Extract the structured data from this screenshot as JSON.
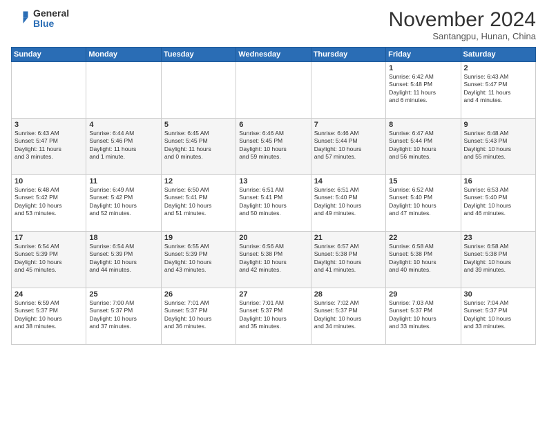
{
  "header": {
    "logo_general": "General",
    "logo_blue": "Blue",
    "month_title": "November 2024",
    "location": "Santangpu, Hunan, China"
  },
  "calendar": {
    "headers": [
      "Sunday",
      "Monday",
      "Tuesday",
      "Wednesday",
      "Thursday",
      "Friday",
      "Saturday"
    ],
    "weeks": [
      [
        {
          "day": "",
          "info": ""
        },
        {
          "day": "",
          "info": ""
        },
        {
          "day": "",
          "info": ""
        },
        {
          "day": "",
          "info": ""
        },
        {
          "day": "",
          "info": ""
        },
        {
          "day": "1",
          "info": "Sunrise: 6:42 AM\nSunset: 5:48 PM\nDaylight: 11 hours\nand 6 minutes."
        },
        {
          "day": "2",
          "info": "Sunrise: 6:43 AM\nSunset: 5:47 PM\nDaylight: 11 hours\nand 4 minutes."
        }
      ],
      [
        {
          "day": "3",
          "info": "Sunrise: 6:43 AM\nSunset: 5:47 PM\nDaylight: 11 hours\nand 3 minutes."
        },
        {
          "day": "4",
          "info": "Sunrise: 6:44 AM\nSunset: 5:46 PM\nDaylight: 11 hours\nand 1 minute."
        },
        {
          "day": "5",
          "info": "Sunrise: 6:45 AM\nSunset: 5:45 PM\nDaylight: 11 hours\nand 0 minutes."
        },
        {
          "day": "6",
          "info": "Sunrise: 6:46 AM\nSunset: 5:45 PM\nDaylight: 10 hours\nand 59 minutes."
        },
        {
          "day": "7",
          "info": "Sunrise: 6:46 AM\nSunset: 5:44 PM\nDaylight: 10 hours\nand 57 minutes."
        },
        {
          "day": "8",
          "info": "Sunrise: 6:47 AM\nSunset: 5:44 PM\nDaylight: 10 hours\nand 56 minutes."
        },
        {
          "day": "9",
          "info": "Sunrise: 6:48 AM\nSunset: 5:43 PM\nDaylight: 10 hours\nand 55 minutes."
        }
      ],
      [
        {
          "day": "10",
          "info": "Sunrise: 6:48 AM\nSunset: 5:42 PM\nDaylight: 10 hours\nand 53 minutes."
        },
        {
          "day": "11",
          "info": "Sunrise: 6:49 AM\nSunset: 5:42 PM\nDaylight: 10 hours\nand 52 minutes."
        },
        {
          "day": "12",
          "info": "Sunrise: 6:50 AM\nSunset: 5:41 PM\nDaylight: 10 hours\nand 51 minutes."
        },
        {
          "day": "13",
          "info": "Sunrise: 6:51 AM\nSunset: 5:41 PM\nDaylight: 10 hours\nand 50 minutes."
        },
        {
          "day": "14",
          "info": "Sunrise: 6:51 AM\nSunset: 5:40 PM\nDaylight: 10 hours\nand 49 minutes."
        },
        {
          "day": "15",
          "info": "Sunrise: 6:52 AM\nSunset: 5:40 PM\nDaylight: 10 hours\nand 47 minutes."
        },
        {
          "day": "16",
          "info": "Sunrise: 6:53 AM\nSunset: 5:40 PM\nDaylight: 10 hours\nand 46 minutes."
        }
      ],
      [
        {
          "day": "17",
          "info": "Sunrise: 6:54 AM\nSunset: 5:39 PM\nDaylight: 10 hours\nand 45 minutes."
        },
        {
          "day": "18",
          "info": "Sunrise: 6:54 AM\nSunset: 5:39 PM\nDaylight: 10 hours\nand 44 minutes."
        },
        {
          "day": "19",
          "info": "Sunrise: 6:55 AM\nSunset: 5:39 PM\nDaylight: 10 hours\nand 43 minutes."
        },
        {
          "day": "20",
          "info": "Sunrise: 6:56 AM\nSunset: 5:38 PM\nDaylight: 10 hours\nand 42 minutes."
        },
        {
          "day": "21",
          "info": "Sunrise: 6:57 AM\nSunset: 5:38 PM\nDaylight: 10 hours\nand 41 minutes."
        },
        {
          "day": "22",
          "info": "Sunrise: 6:58 AM\nSunset: 5:38 PM\nDaylight: 10 hours\nand 40 minutes."
        },
        {
          "day": "23",
          "info": "Sunrise: 6:58 AM\nSunset: 5:38 PM\nDaylight: 10 hours\nand 39 minutes."
        }
      ],
      [
        {
          "day": "24",
          "info": "Sunrise: 6:59 AM\nSunset: 5:37 PM\nDaylight: 10 hours\nand 38 minutes."
        },
        {
          "day": "25",
          "info": "Sunrise: 7:00 AM\nSunset: 5:37 PM\nDaylight: 10 hours\nand 37 minutes."
        },
        {
          "day": "26",
          "info": "Sunrise: 7:01 AM\nSunset: 5:37 PM\nDaylight: 10 hours\nand 36 minutes."
        },
        {
          "day": "27",
          "info": "Sunrise: 7:01 AM\nSunset: 5:37 PM\nDaylight: 10 hours\nand 35 minutes."
        },
        {
          "day": "28",
          "info": "Sunrise: 7:02 AM\nSunset: 5:37 PM\nDaylight: 10 hours\nand 34 minutes."
        },
        {
          "day": "29",
          "info": "Sunrise: 7:03 AM\nSunset: 5:37 PM\nDaylight: 10 hours\nand 33 minutes."
        },
        {
          "day": "30",
          "info": "Sunrise: 7:04 AM\nSunset: 5:37 PM\nDaylight: 10 hours\nand 33 minutes."
        }
      ]
    ]
  }
}
